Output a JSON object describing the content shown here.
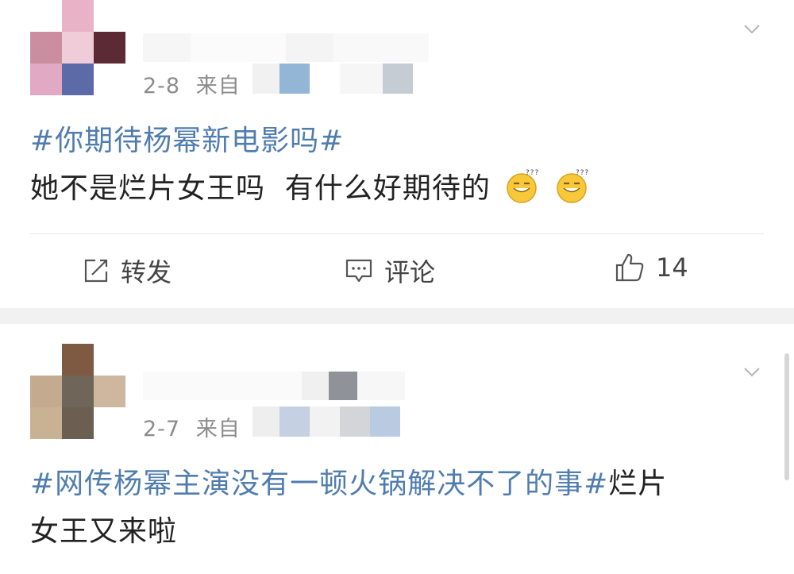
{
  "posts": [
    {
      "date": "2-8",
      "source_prefix": "来自",
      "topic": "#你期待杨幂新电影吗#",
      "text": "她不是烂片女王吗  有什么好期待的",
      "emoji_count": 2,
      "actions": {
        "repost": "转发",
        "comment": "评论",
        "like_count": "14"
      }
    },
    {
      "date": "2-7",
      "source_prefix": "来自",
      "topic": "#网传杨幂主演没有一顿火锅解决不了的事#",
      "text_inline": "烂片",
      "text_line2": "女王又来啦"
    }
  ],
  "colors": {
    "topic": "#507daf",
    "meta": "#8c8c8c",
    "body": "#222222",
    "gap": "#f1f1f1"
  },
  "icons": [
    "chevron-down-icon",
    "repost-icon",
    "comment-icon",
    "like-icon",
    "sweat-smile-emoji"
  ]
}
